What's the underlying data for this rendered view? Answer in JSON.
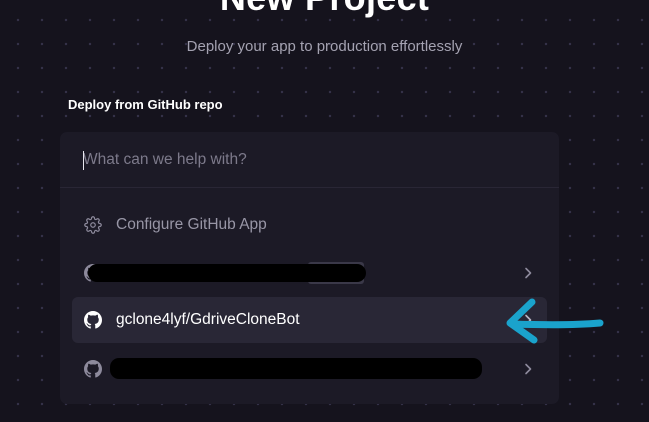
{
  "header": {
    "title": "New Project",
    "subtitle": "Deploy your app to production effortlessly"
  },
  "deploy": {
    "section_label": "Deploy from GitHub repo",
    "search": {
      "placeholder": "What can we help with?",
      "value": ""
    },
    "items": [
      {
        "type": "action",
        "icon": "gear-icon",
        "label": "Configure GitHub App"
      },
      {
        "type": "repo",
        "icon": "github-icon",
        "label": "",
        "redacted": true,
        "has_chevron": true
      },
      {
        "type": "repo",
        "icon": "github-icon",
        "label": "gclone4lyf/GdriveCloneBot",
        "selected": true,
        "has_chevron": true
      },
      {
        "type": "repo",
        "icon": "github-icon",
        "label": "",
        "redacted": true,
        "has_chevron": true
      }
    ]
  },
  "colors": {
    "background": "#15131d",
    "panel": "#1c1a26",
    "selected_row": "#292736",
    "annotation_arrow": "#1aa3cc"
  }
}
